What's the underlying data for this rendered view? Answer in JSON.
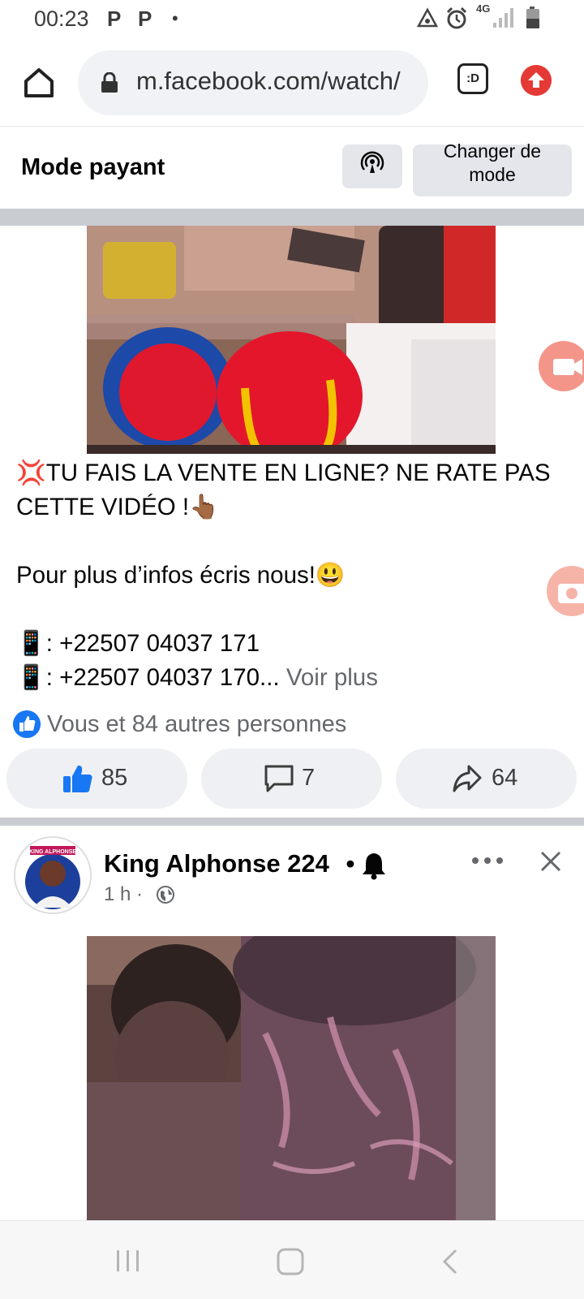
{
  "status_bar": {
    "time": "00:23",
    "notif_1": "P",
    "notif_2": "P",
    "dot": "•",
    "network": "4G"
  },
  "browser": {
    "url": "m.facebook.com/watch/",
    "tab_label": ":D"
  },
  "mode_header": {
    "title": "Mode payant",
    "change_mode_line1": "Changer de",
    "change_mode_line2": "mode"
  },
  "post1": {
    "text_line1": "💢TU FAIS LA VENTE EN LIGNE? NE RATE PAS",
    "text_line2": "CETTE VIDÉO !👆🏾",
    "text_line3": "Pour plus d’infos écris nous!😃",
    "phone1": "📱: +22507 04037 171",
    "phone2": "📱: +22507 04037 170...",
    "see_more": " Voir plus",
    "reactions": "Vous et 84 autres personnes",
    "likes": "85",
    "comments": "7",
    "shares": "64"
  },
  "post2": {
    "author": "King Alphonse 224",
    "separator": "•",
    "time": "1 h ·",
    "avatar_banner": "KING ALPHONSE"
  },
  "colors": {
    "facebook_blue": "#1877f2",
    "upload_red": "#e53935"
  }
}
